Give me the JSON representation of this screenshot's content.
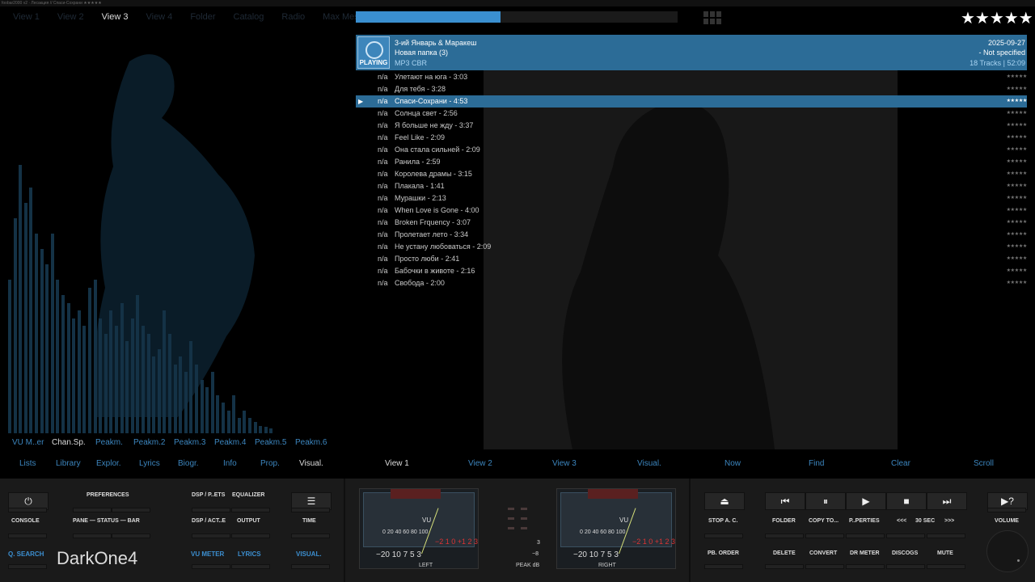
{
  "titlebar": {
    "text": "foobar2000 v2 · Лесакция // Спаси-Сохрани ★★★★★"
  },
  "tabs": [
    {
      "label": "View 1"
    },
    {
      "label": "View 2"
    },
    {
      "label": "View 3",
      "active": true
    },
    {
      "label": "View 4"
    },
    {
      "label": "Folder"
    },
    {
      "label": "Catalog"
    },
    {
      "label": "Radio"
    },
    {
      "label": "Max Mess"
    }
  ],
  "progress": {
    "fraction": 0.45
  },
  "rating": {
    "stars": "★★★★★"
  },
  "now_playing": {
    "cover_label": "PLAYING",
    "artist_album": "3-ий Январь & Маракеш",
    "folder": "Новая папка (3)",
    "format": "MP3 CBR",
    "date": "2025-09-27",
    "genre": "- Not specified",
    "summary": "18 Tracks | 52:09"
  },
  "tracks": [
    {
      "num": "n/a",
      "title": "Улетают на юга - 3:03",
      "rating": "★★★★★"
    },
    {
      "num": "n/a",
      "title": "Для тебя - 3:28",
      "rating": "★★★★★"
    },
    {
      "num": "n/a",
      "title": "Спаси-Сохрани - 4:53",
      "rating": "★★★★★",
      "playing": true,
      "marker": "▶"
    },
    {
      "num": "n/a",
      "title": "Солнца свет - 2:56",
      "rating": "★★★★★"
    },
    {
      "num": "n/a",
      "title": "Я больше не жду - 3:37",
      "rating": "★★★★★"
    },
    {
      "num": "n/a",
      "title": "Feel Like - 2:09",
      "rating": "★★★★★"
    },
    {
      "num": "n/a",
      "title": "Она стала сильней - 2:09",
      "rating": "★★★★★"
    },
    {
      "num": "n/a",
      "title": "Ранила - 2:59",
      "rating": "★★★★★"
    },
    {
      "num": "n/a",
      "title": "Королева драмы - 3:15",
      "rating": "★★★★★"
    },
    {
      "num": "n/a",
      "title": "Плакала - 1:41",
      "rating": "★★★★★"
    },
    {
      "num": "n/a",
      "title": "Мурашки - 2:13",
      "rating": "★★★★★"
    },
    {
      "num": "n/a",
      "title": "When Love is Gone - 4:00",
      "rating": "★★★★★"
    },
    {
      "num": "n/a",
      "title": "Broken Frquency - 3:07",
      "rating": "★★★★★"
    },
    {
      "num": "n/a",
      "title": "Пролетает лето - 3:34",
      "rating": "★★★★★"
    },
    {
      "num": "n/a",
      "title": "Не устану любоваться - 2:09",
      "rating": "★★★★★"
    },
    {
      "num": "n/a",
      "title": "Просто люби - 2:41",
      "rating": "★★★★★"
    },
    {
      "num": "n/a",
      "title": "Бабочки в животе - 2:16",
      "rating": "★★★★★"
    },
    {
      "num": "n/a",
      "title": "Свобода - 2:00",
      "rating": "★★★★★"
    }
  ],
  "vis_tabs": [
    {
      "label": "VU M..er"
    },
    {
      "label": "Chan.Sp.",
      "active": true
    },
    {
      "label": "Peakm."
    },
    {
      "label": "Peakm.2"
    },
    {
      "label": "Peakm.3"
    },
    {
      "label": "Peakm.4"
    },
    {
      "label": "Peakm.5"
    },
    {
      "label": "Peakm.6"
    }
  ],
  "left_tabs": [
    {
      "label": "Lists"
    },
    {
      "label": "Library"
    },
    {
      "label": "Explor."
    },
    {
      "label": "Lyrics"
    },
    {
      "label": "Biogr."
    },
    {
      "label": "Info"
    },
    {
      "label": "Prop."
    },
    {
      "label": "Visual.",
      "active": true
    }
  ],
  "mid_tabs": [
    {
      "label": "View 1",
      "active": true
    },
    {
      "label": "View 2"
    },
    {
      "label": "View 3"
    },
    {
      "label": "Visual."
    },
    {
      "label": "Now"
    },
    {
      "label": "Find"
    },
    {
      "label": "Clear"
    },
    {
      "label": "Scroll"
    }
  ],
  "controls": {
    "console": "CONSOLE",
    "preferences": "PREFERENCES",
    "pane_status_bar": "PANE — STATUS — BAR",
    "dsp_presets": "DSP / P..ETS",
    "equalizer": "EQUALIZER",
    "dsp_active": "DSP / ACT..E",
    "output": "OUTPUT",
    "time": "TIME",
    "q_search": "Q. SEARCH",
    "vu_meter": "VU METER",
    "lyrics": "LYRICS",
    "visual": "VISUAL.",
    "theme": "DarkOne4",
    "stop_ac": "STOP A. C.",
    "pb_order": "PB. ORDER",
    "folder": "FOLDER",
    "copy_to": "COPY TO...",
    "properties": "P..PERTIES",
    "back": "<<<",
    "seek": "30 SEC",
    "fwd": ">>>",
    "delete": "DELETE",
    "convert": "CONVERT",
    "dr_meter": "DR METER",
    "discogs": "DISCOGS",
    "mute": "MUTE",
    "volume": "VOLUME",
    "power_icon": "⏻",
    "menu_icon": "☰",
    "eject_icon": "⏏",
    "prev_icon": "⏮",
    "pause_icon": "⏸",
    "play_icon": "▶",
    "stop_icon": "■",
    "next_icon": "⏭",
    "help_icon": "▶?"
  },
  "vu": {
    "vu_text": "VU",
    "scale": "0 20 40 60 80 100",
    "neg": "−20 10 7 5 3",
    "red": "−2 1 0 +1 2 3",
    "left": "LEFT",
    "right": "RIGHT",
    "peak": "PEAK dB",
    "p3": "3",
    "p8": "−8"
  }
}
